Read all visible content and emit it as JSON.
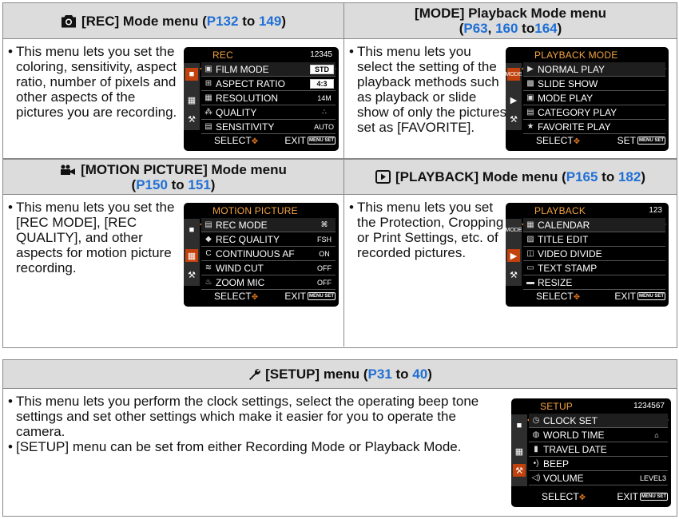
{
  "rec": {
    "title_icon": "camera-icon",
    "title_pre": "[REC] Mode menu (",
    "ref1": "P132",
    "to": " to ",
    "ref2": "149",
    "title_post": ")",
    "description": [
      "This menu lets you set the coloring, sensitivity, aspect ratio, number of pixels and other aspects of the pictures you are recording."
    ],
    "screen": {
      "title": "REC",
      "pages": "12345",
      "rows": [
        {
          "icon": "film-icon",
          "label": "FILM MODE",
          "value": "STD"
        },
        {
          "icon": "aspect-icon",
          "label": "ASPECT RATIO",
          "value": "4:3"
        },
        {
          "icon": "resolution-icon",
          "label": "RESOLUTION",
          "value": "14M"
        },
        {
          "icon": "quality-icon",
          "label": "QUALITY",
          "value": "∴"
        },
        {
          "icon": "iso-icon",
          "label": "SENSITIVITY",
          "value": "AUTO"
        }
      ],
      "select": "SELECT",
      "exit": "EXIT"
    }
  },
  "mode": {
    "title_line1": "[MODE] Playback Mode menu",
    "ref1": "P63",
    "sep": ", ",
    "ref2": "160",
    "to": " to",
    "ref3": "164",
    "description": [
      "This menu lets you select the setting of the playback methods such as playback or slide show of only the pictures set as [FAVORITE]."
    ],
    "screen": {
      "title": "PLAYBACK MODE",
      "rows": [
        {
          "icon": "play-icon",
          "label": "NORMAL PLAY"
        },
        {
          "icon": "slideshow-icon",
          "label": "SLIDE SHOW"
        },
        {
          "icon": "mode-play-icon",
          "label": "MODE PLAY"
        },
        {
          "icon": "category-icon",
          "label": "CATEGORY PLAY"
        },
        {
          "icon": "star-icon",
          "label": "FAVORITE PLAY"
        }
      ],
      "select": "SELECT",
      "set": "SET"
    }
  },
  "motion": {
    "title_icon": "movie-icon",
    "title_line1": "[MOTION PICTURE] Mode menu",
    "ref1": "P150",
    "to": " to ",
    "ref2": "151",
    "description": [
      "This menu lets you set the [REC MODE], [REC QUALITY], and other aspects for motion picture recording."
    ],
    "screen": {
      "title": "MOTION PICTURE",
      "rows": [
        {
          "icon": "rec-mode-icon",
          "label": "REC MODE",
          "value": "⌘"
        },
        {
          "icon": "rec-quality-icon",
          "label": "REC QUALITY",
          "value": "FSH"
        },
        {
          "icon": "caf-icon",
          "label": "CONTINUOUS AF",
          "value": "ON"
        },
        {
          "icon": "wind-icon",
          "label": "WIND CUT",
          "value": "OFF"
        },
        {
          "icon": "zoom-mic-icon",
          "label": "ZOOM MIC",
          "value": "OFF"
        }
      ],
      "select": "SELECT",
      "exit": "EXIT"
    }
  },
  "playback": {
    "title_icon": "play-box-icon",
    "title_pre": "[PLAYBACK] Mode menu (",
    "ref1": "P165",
    "to": " to ",
    "ref2": "182",
    "title_post": ")",
    "description": [
      "This menu lets you set the Protection, Cropping or Print Settings, etc. of recorded pictures."
    ],
    "screen": {
      "title": "PLAYBACK",
      "pages": "123",
      "rows": [
        {
          "icon": "calendar-icon",
          "label": "CALENDAR"
        },
        {
          "icon": "title-edit-icon",
          "label": "TITLE EDIT"
        },
        {
          "icon": "video-divide-icon",
          "label": "VIDEO DIVIDE"
        },
        {
          "icon": "text-stamp-icon",
          "label": "TEXT STAMP"
        },
        {
          "icon": "resize-icon",
          "label": "RESIZE"
        }
      ],
      "select": "SELECT",
      "exit": "EXIT"
    }
  },
  "setup": {
    "title_icon": "wrench-icon",
    "title_pre": "[SETUP] menu (",
    "ref1": "P31",
    "to": " to ",
    "ref2": "40",
    "title_post": ")",
    "description": [
      "This menu lets you perform the clock settings, select the operating beep tone settings and set other settings which make it easier for you to operate the camera.",
      "[SETUP] menu can be set from either Recording Mode or Playback Mode."
    ],
    "screen": {
      "title": "SETUP",
      "pages": "1234567",
      "rows": [
        {
          "icon": "clock-icon",
          "label": "CLOCK SET",
          "value": ""
        },
        {
          "icon": "globe-icon",
          "label": "WORLD TIME",
          "value": "⌂"
        },
        {
          "icon": "travel-icon",
          "label": "TRAVEL DATE",
          "value": ""
        },
        {
          "icon": "beep-icon",
          "label": "BEEP",
          "value": ""
        },
        {
          "icon": "volume-icon",
          "label": "VOLUME",
          "value": "LEVEL3"
        }
      ],
      "select": "SELECT",
      "exit": "EXIT"
    }
  },
  "menu_badge": "MENU SET"
}
